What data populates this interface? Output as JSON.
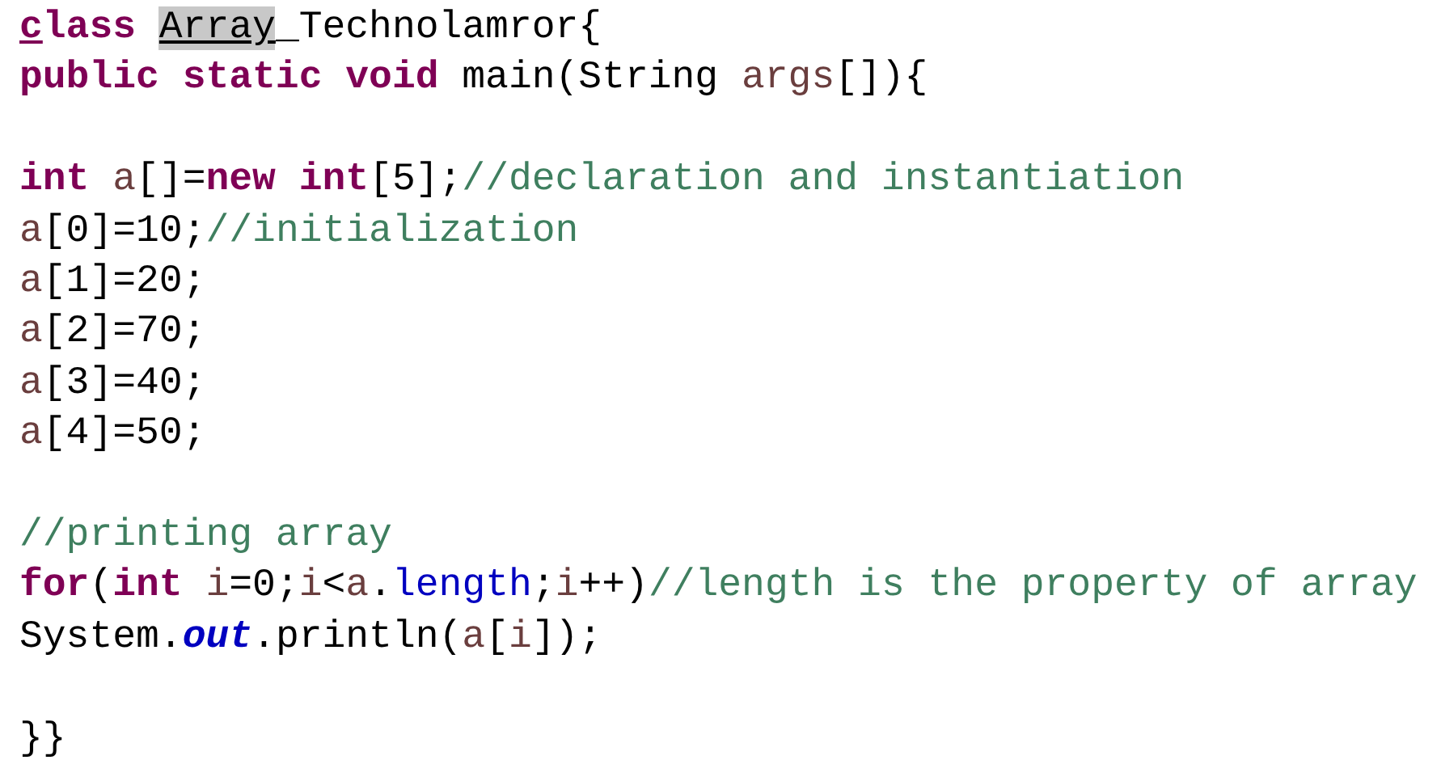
{
  "code_lines": [
    {
      "kind": "code",
      "tokens": [
        {
          "kind": "keyword",
          "text": "c",
          "underlined": true
        },
        {
          "kind": "keyword",
          "text": "lass "
        },
        {
          "kind": "plain",
          "text": "Array",
          "highlighted": true,
          "underlined": true
        },
        {
          "kind": "plain",
          "text": "_Technolamror{"
        }
      ]
    },
    {
      "kind": "code",
      "tokens": [
        {
          "kind": "keyword",
          "text": "public static void "
        },
        {
          "kind": "plain",
          "text": "main(String "
        },
        {
          "kind": "variable",
          "text": "args"
        },
        {
          "kind": "plain",
          "text": "[]){"
        }
      ]
    },
    {
      "kind": "blank"
    },
    {
      "kind": "code",
      "tokens": [
        {
          "kind": "keyword",
          "text": "int "
        },
        {
          "kind": "variable",
          "text": "a"
        },
        {
          "kind": "plain",
          "text": "[]="
        },
        {
          "kind": "keyword",
          "text": "new int"
        },
        {
          "kind": "plain",
          "text": "[5];"
        },
        {
          "kind": "comment",
          "text": "//declaration and instantiation"
        }
      ]
    },
    {
      "kind": "code",
      "tokens": [
        {
          "kind": "variable",
          "text": "a"
        },
        {
          "kind": "plain",
          "text": "[0]=10;"
        },
        {
          "kind": "comment",
          "text": "//initialization"
        }
      ]
    },
    {
      "kind": "code",
      "tokens": [
        {
          "kind": "variable",
          "text": "a"
        },
        {
          "kind": "plain",
          "text": "[1]=20;"
        }
      ]
    },
    {
      "kind": "code",
      "tokens": [
        {
          "kind": "variable",
          "text": "a"
        },
        {
          "kind": "plain",
          "text": "[2]=70;"
        }
      ]
    },
    {
      "kind": "code",
      "tokens": [
        {
          "kind": "variable",
          "text": "a"
        },
        {
          "kind": "plain",
          "text": "[3]=40;"
        }
      ]
    },
    {
      "kind": "code",
      "tokens": [
        {
          "kind": "variable",
          "text": "a"
        },
        {
          "kind": "plain",
          "text": "[4]=50;"
        }
      ]
    },
    {
      "kind": "blank"
    },
    {
      "kind": "code",
      "tokens": [
        {
          "kind": "comment",
          "text": "//printing array"
        }
      ]
    },
    {
      "kind": "code",
      "tokens": [
        {
          "kind": "keyword",
          "text": "for"
        },
        {
          "kind": "plain",
          "text": "("
        },
        {
          "kind": "keyword",
          "text": "int "
        },
        {
          "kind": "variable",
          "text": "i"
        },
        {
          "kind": "plain",
          "text": "=0;"
        },
        {
          "kind": "variable",
          "text": "i"
        },
        {
          "kind": "plain",
          "text": "<"
        },
        {
          "kind": "variable",
          "text": "a"
        },
        {
          "kind": "plain",
          "text": "."
        },
        {
          "kind": "field",
          "text": "length"
        },
        {
          "kind": "plain",
          "text": ";"
        },
        {
          "kind": "variable",
          "text": "i"
        },
        {
          "kind": "plain",
          "text": "++)"
        },
        {
          "kind": "comment",
          "text": "//length is the property of array"
        }
      ]
    },
    {
      "kind": "code",
      "tokens": [
        {
          "kind": "plain",
          "text": "System."
        },
        {
          "kind": "static_field",
          "text": "out"
        },
        {
          "kind": "plain",
          "text": ".println("
        },
        {
          "kind": "variable",
          "text": "a"
        },
        {
          "kind": "plain",
          "text": "["
        },
        {
          "kind": "variable",
          "text": "i"
        },
        {
          "kind": "plain",
          "text": "]);"
        }
      ]
    },
    {
      "kind": "blank"
    },
    {
      "kind": "code",
      "tokens": [
        {
          "kind": "plain",
          "text": "}}"
        }
      ]
    }
  ]
}
